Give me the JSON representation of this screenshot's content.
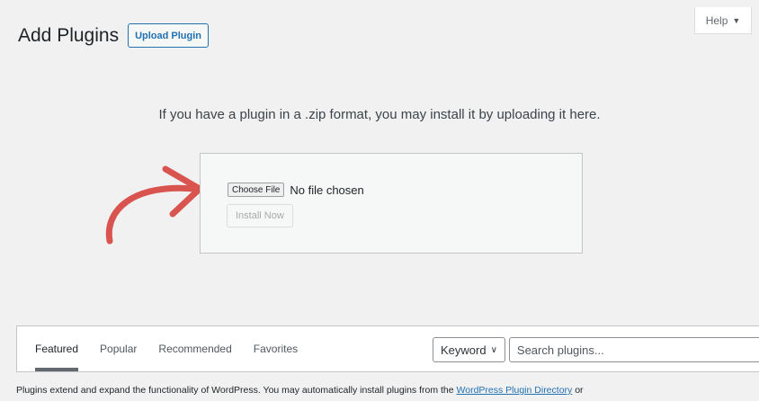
{
  "header": {
    "title": "Add Plugins",
    "upload_button": "Upload Plugin",
    "help_tab": "Help"
  },
  "upload": {
    "instructions": "If you have a plugin in a .zip format, you may install it by uploading it here.",
    "choose_file_label": "Choose File",
    "file_status": "No file chosen",
    "install_button": "Install Now"
  },
  "filters": {
    "tabs": [
      {
        "label": "Featured",
        "current": true
      },
      {
        "label": "Popular"
      },
      {
        "label": "Recommended"
      },
      {
        "label": "Favorites"
      }
    ],
    "search_type": "Keyword",
    "search_placeholder": "Search plugins..."
  },
  "footer": {
    "text_before": "Plugins extend and expand the functionality of WordPress. You may automatically install plugins from the ",
    "link": "WordPress Plugin Directory",
    "text_after": " or"
  },
  "colors": {
    "accent": "#2271b1",
    "arrow": "#d9534f",
    "background": "#f1f1f1"
  }
}
